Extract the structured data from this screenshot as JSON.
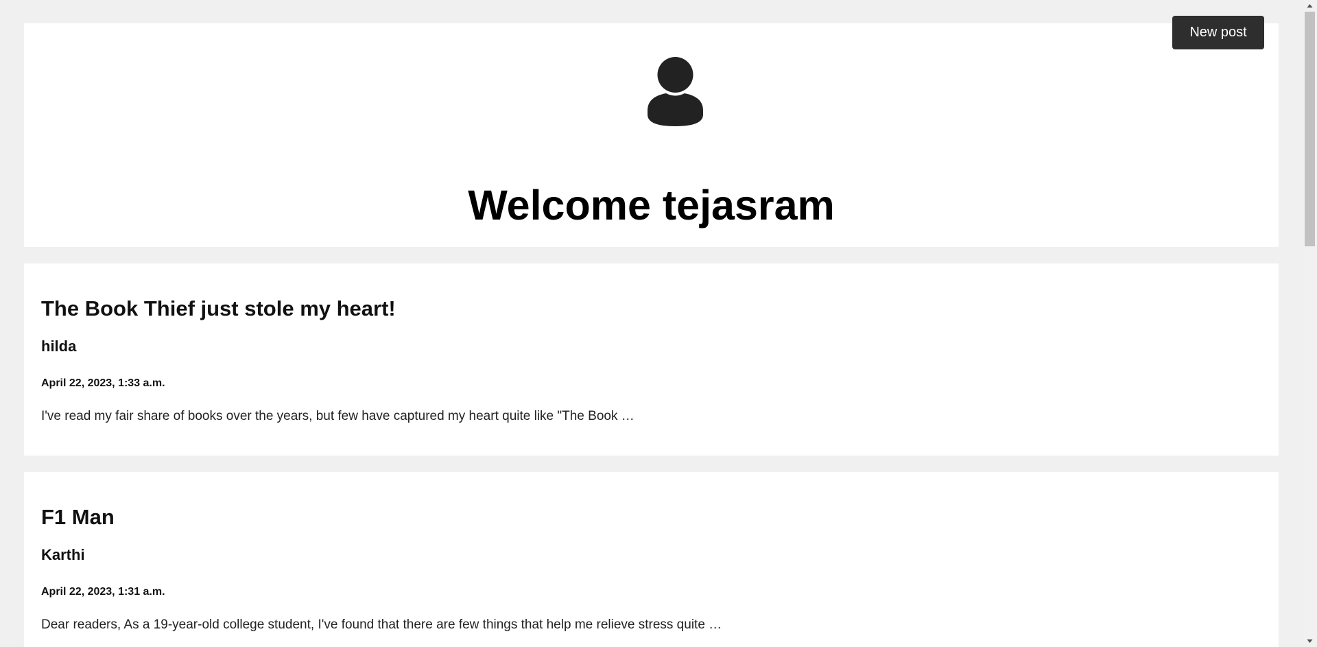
{
  "header": {
    "avatar_icon": "user-silhouette-icon",
    "welcome_text": "Welcome tejasram",
    "new_post_label": "New post"
  },
  "posts": [
    {
      "title": "The Book Thief just stole my heart!",
      "author": "hilda",
      "date": "April 22, 2023, 1:33 a.m.",
      "excerpt": "I've read my fair share of books over the years, but few have captured my heart quite like \"The Book …"
    },
    {
      "title": "F1 Man",
      "author": "Karthi",
      "date": "April 22, 2023, 1:31 a.m.",
      "excerpt": "Dear readers, As a 19-year-old college student, I've found that there are few things that help me relieve stress quite …"
    }
  ],
  "scrollbar": {
    "up_icon": "scroll-up-arrow-icon",
    "down_icon": "scroll-down-arrow-icon"
  },
  "colors": {
    "page_background": "#f0f0f0",
    "card_background": "#ffffff",
    "button_background": "#2e2e2e",
    "button_text": "#ffffff",
    "icon_color": "#222222"
  }
}
